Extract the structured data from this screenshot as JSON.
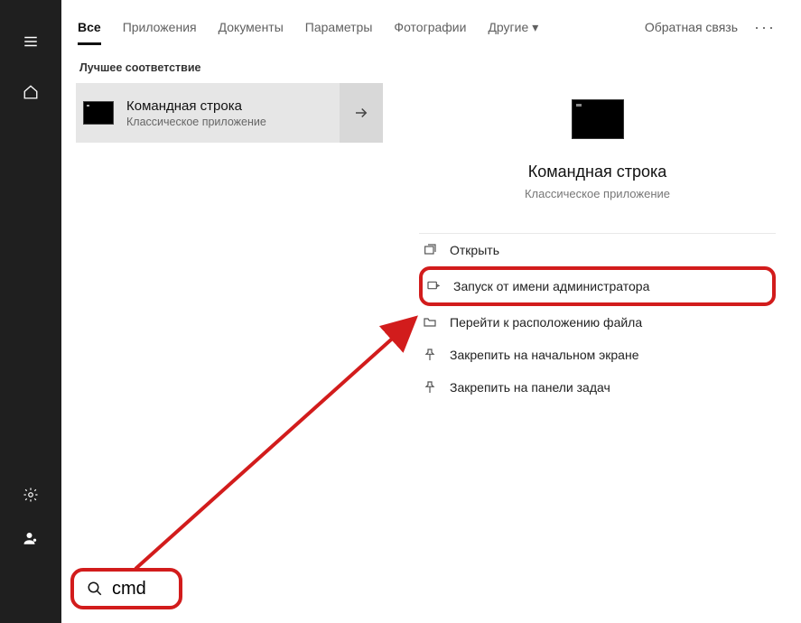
{
  "tabs": {
    "all": "Все",
    "apps": "Приложения",
    "docs": "Документы",
    "settings": "Параметры",
    "photos": "Фотографии",
    "more": "Другие"
  },
  "feedback": "Обратная связь",
  "ellipsis": "···",
  "section_best_match": "Лучшее соответствие",
  "best_match": {
    "title": "Командная строка",
    "subtitle": "Классическое приложение"
  },
  "preview": {
    "title": "Командная строка",
    "subtitle": "Классическое приложение"
  },
  "actions": {
    "open": "Открыть",
    "run_admin": "Запуск от имени администратора",
    "open_location": "Перейти к расположению файла",
    "pin_start": "Закрепить на начальном экране",
    "pin_taskbar": "Закрепить на панели задач"
  },
  "search": {
    "value": "cmd"
  }
}
